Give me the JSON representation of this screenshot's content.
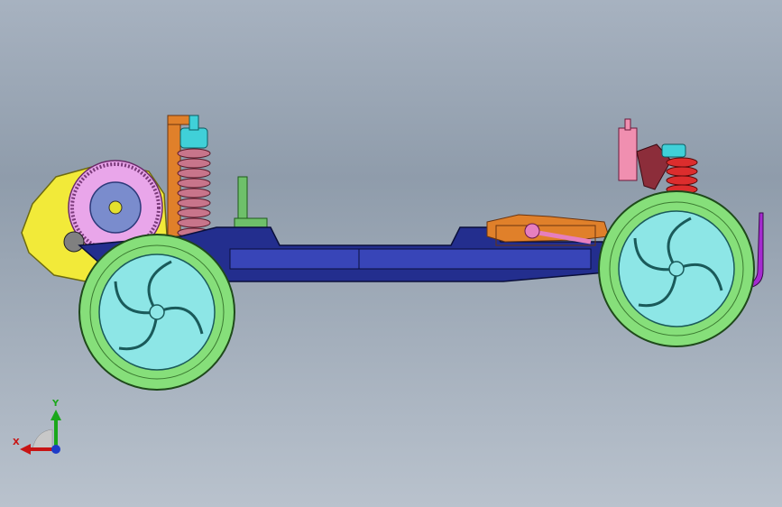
{
  "viewport": {
    "background_top": "#a7b2c0",
    "background_bottom": "#b9c2cd"
  },
  "model": {
    "subject": "rc-car-chassis-side-view",
    "colors": {
      "chassis_plate": "#232e8e",
      "chassis_plate_light": "#3845b8",
      "tire": "#86df7a",
      "rim": "#8de6e6",
      "gearbox": "#f2ea39",
      "spur_gear": "#e9a6ea",
      "spring_front": "#c8758b",
      "spring_rear": "#dc2d2d",
      "shock_cap": "#40d0d8",
      "bracket_orange": "#e0802a",
      "rear_tower": "#8c2d3a",
      "post_green": "#6ec06a",
      "pink_rod": "#e67fbe",
      "bumper_purple": "#a52ad0"
    }
  },
  "triad": {
    "x_label": "X",
    "y_label": "Y",
    "x_color": "#c81414",
    "y_color": "#1aa71a",
    "z_color": "#1e3cc8"
  }
}
